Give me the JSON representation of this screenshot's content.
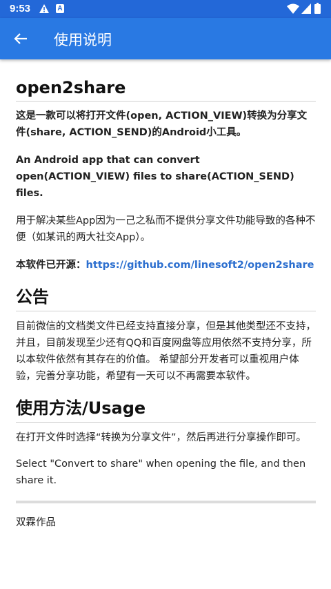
{
  "status_bar": {
    "time": "9:53",
    "a_label": "A"
  },
  "app_bar": {
    "title": "使用说明"
  },
  "doc": {
    "title": "open2share",
    "intro_cn": "这是一款可以将打开文件(open, ACTION_VIEW)转换为分享文件(share, ACTION_SEND)的Android小工具。",
    "intro_en": "An Android app that can convert open(ACTION_VIEW) files to share(ACTION_SEND) files.",
    "purpose": "用于解决某些App因为一己之私而不提供分享文件功能导致的各种不便（如某讯的两大社交App）。",
    "open_source_label": "本软件已开源：",
    "repo_link": "https://github.com/linesoft2/open2share",
    "notice_heading": "公告",
    "notice_text": "目前微信的文档类文件已经支持直接分享，但是其他类型还不支持，并且，目前发现至少还有QQ和百度网盘等应用依然不支持分享，所以本软件依然有其存在的价值。 希望部分开发者可以重视用户体验，完善分享功能，希望有一天可以不再需要本软件。",
    "usage_heading": "使用方法/Usage",
    "usage_cn": "在打开文件时选择“转换为分享文件”，然后再进行分享操作即可。",
    "usage_en": "Select \"Convert to share\" when opening the file, and then share it.",
    "author": "双霖作品"
  }
}
